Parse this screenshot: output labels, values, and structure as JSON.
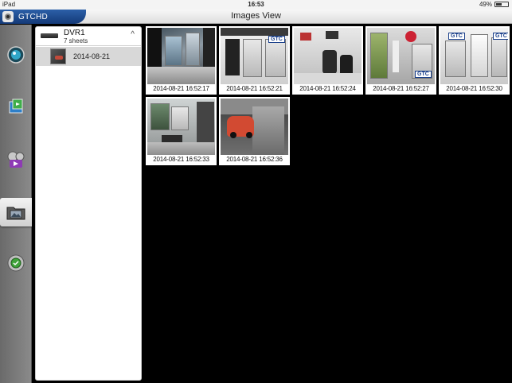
{
  "status_bar": {
    "device": "iPad",
    "time": "16:53",
    "battery": "49%",
    "battery_level": 0.49
  },
  "nav": {
    "brand": "GTCHD",
    "title": "Images View"
  },
  "sidebar": {
    "items": [
      {
        "name": "live-view-icon",
        "active": false
      },
      {
        "name": "playback-icon",
        "active": false
      },
      {
        "name": "video-icon",
        "active": false
      },
      {
        "name": "image-folder-icon",
        "active": true
      },
      {
        "name": "settings-icon",
        "active": false
      }
    ]
  },
  "tree": {
    "device": {
      "name": "DVR1",
      "count": "7 sheets",
      "expanded_icon": "chevron-up-icon"
    },
    "dates": [
      {
        "label": "2014-08-21"
      }
    ]
  },
  "images": [
    {
      "caption": "2014-08-21 16:52:17"
    },
    {
      "caption": "2014-08-21 16:52:21"
    },
    {
      "caption": "2014-08-21 16:52:24"
    },
    {
      "caption": "2014-08-21 16:52:27"
    },
    {
      "caption": "2014-08-21 16:52:30"
    },
    {
      "caption": "2014-08-21 16:52:33"
    },
    {
      "caption": "2014-08-21 16:52:36"
    }
  ],
  "colors": {
    "brand_blue": "#1f4f98",
    "grid_bg": "#000000",
    "sidebar_gray": "#7a7a7a"
  }
}
